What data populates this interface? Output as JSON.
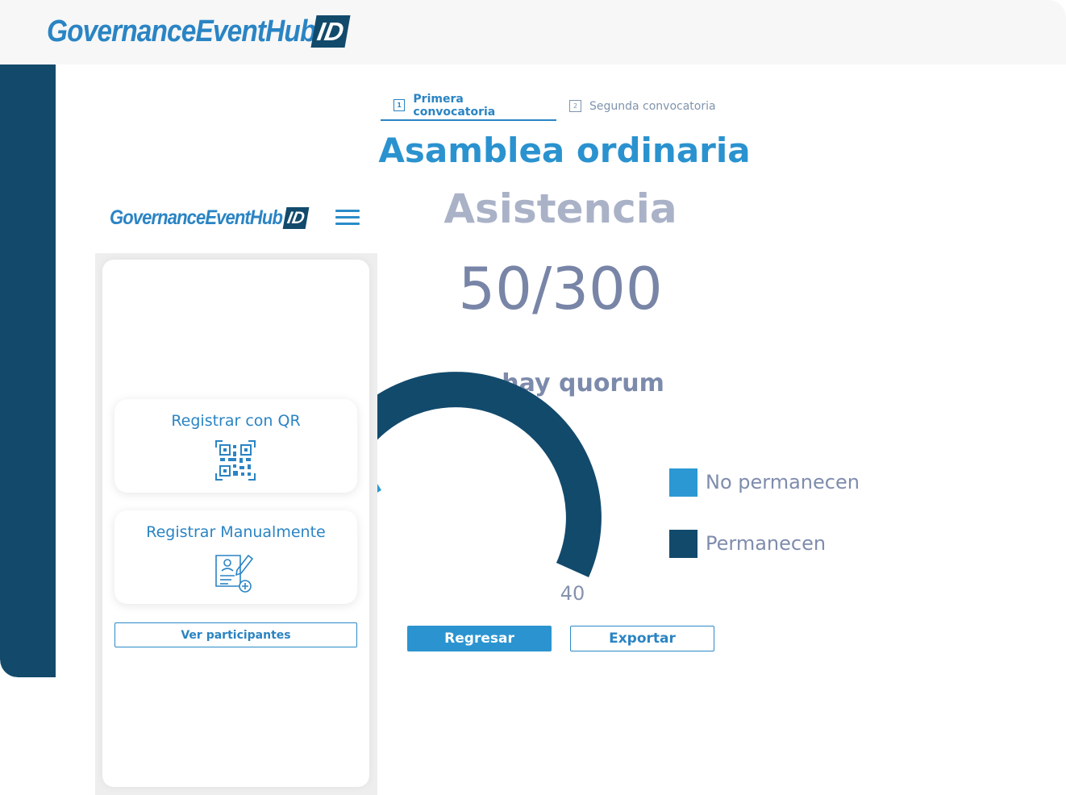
{
  "desktop": {
    "logo_text": "GovernanceEventHub",
    "logo_badge": "ID",
    "tabs": [
      {
        "num": "1",
        "label": "Primera convocatoria"
      },
      {
        "num": "2",
        "label": "Segunda convocatoria"
      }
    ],
    "title": "Asamblea ordinaria",
    "subtitle": "Asistencia",
    "attendance": "50/300",
    "quorum_status": "No hay quorum",
    "gauge_value": "40",
    "legend": [
      {
        "label": "No permanecen",
        "color": "#2b98d3"
      },
      {
        "label": "Permanecen",
        "color": "#124a6c"
      }
    ],
    "buttons": {
      "back": "Regresar",
      "export": "Exportar"
    }
  },
  "mobile": {
    "logo_text": "GovernanceEventHub",
    "logo_badge": "ID",
    "menu_icon": "hamburger-icon",
    "cards": [
      {
        "label": "Registrar con QR",
        "icon": "qr-code-icon"
      },
      {
        "label": "Registrar Manualmente",
        "icon": "manual-form-icon"
      }
    ],
    "view_participants": "Ver participantes"
  },
  "colors": {
    "brand_dark": "#124a6c",
    "brand_light": "#2a92cf",
    "muted_text": "#7f8cad"
  }
}
